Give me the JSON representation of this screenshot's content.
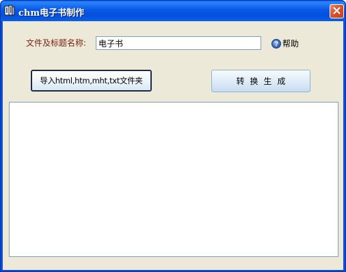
{
  "window": {
    "title": "chm电子书制作",
    "icon": "book-icon",
    "close_icon": "close-icon"
  },
  "form": {
    "name_label": "文件及标题名称:",
    "name_value": "电子书",
    "help_icon": "question-icon",
    "help_label": "帮助"
  },
  "buttons": {
    "import_label": "导入html,htm,mht,txt文件夹",
    "convert_label": "转换生成"
  },
  "log": {
    "content": ""
  },
  "colors": {
    "titlebar": "#0758e6",
    "client_bg": "#ece9d8",
    "label_text": "#7a1e12",
    "close_button": "#d8532c",
    "input_border": "#7f9db9"
  }
}
